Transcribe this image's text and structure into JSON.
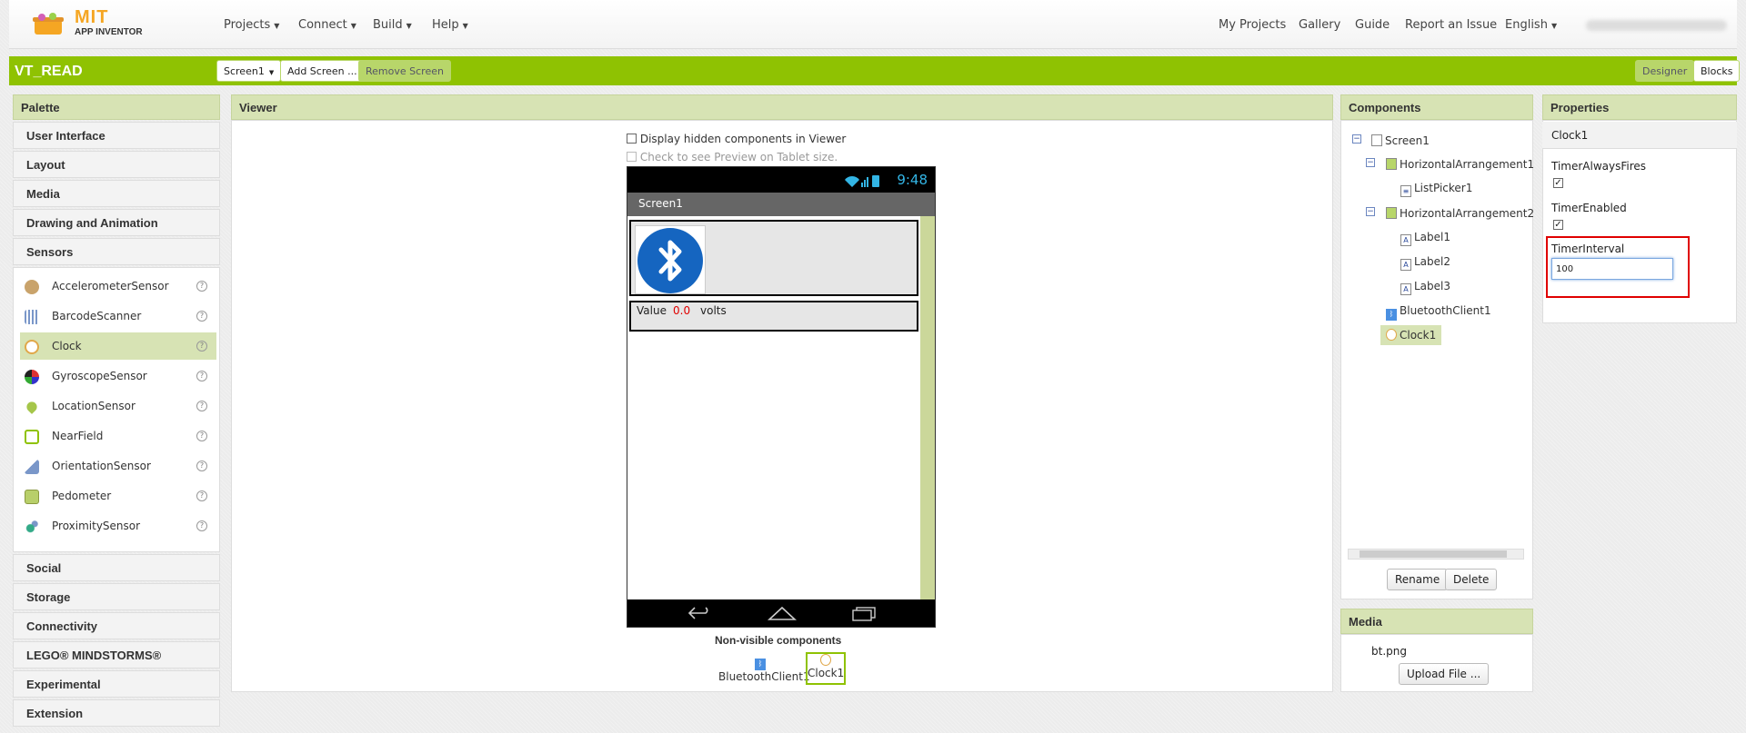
{
  "app": {
    "logo_title": "MIT",
    "logo_subtitle": "APP INVENTOR"
  },
  "topnav": {
    "menus": [
      {
        "label": "Projects"
      },
      {
        "label": "Connect"
      },
      {
        "label": "Build"
      },
      {
        "label": "Help"
      }
    ],
    "right_links": [
      {
        "label": "My Projects"
      },
      {
        "label": "Gallery"
      },
      {
        "label": "Guide"
      },
      {
        "label": "Report an Issue"
      },
      {
        "label": "English"
      }
    ]
  },
  "project": {
    "title": "VT_READ",
    "screen_select": "Screen1",
    "add_screen": "Add Screen ...",
    "remove_screen": "Remove Screen",
    "designer": "Designer",
    "blocks": "Blocks"
  },
  "palette": {
    "header": "Palette",
    "categories_top": [
      "User Interface",
      "Layout",
      "Media",
      "Drawing and Animation",
      "Sensors"
    ],
    "sensors": [
      "AccelerometerSensor",
      "BarcodeScanner",
      "Clock",
      "GyroscopeSensor",
      "LocationSensor",
      "NearField",
      "OrientationSensor",
      "Pedometer",
      "ProximitySensor"
    ],
    "selected_sensor": "Clock",
    "categories_bottom": [
      "Social",
      "Storage",
      "Connectivity",
      "LEGO® MINDSTORMS®",
      "Experimental",
      "Extension"
    ]
  },
  "viewer": {
    "header": "Viewer",
    "display_hidden": "Display hidden components in Viewer",
    "tablet_preview": "Check to see Preview on Tablet size.",
    "time": "9:48",
    "screen_title": "Screen1",
    "value_label": "Value",
    "value": "0.0",
    "unit": "volts",
    "nonvisible_title": "Non-visible components",
    "nonvisible": [
      "BluetoothClient1",
      "Clock1"
    ]
  },
  "components": {
    "header": "Components",
    "tree": [
      {
        "label": "Screen1",
        "level": 0,
        "toggle": "−"
      },
      {
        "label": "HorizontalArrangement1",
        "level": 1,
        "toggle": "−"
      },
      {
        "label": "ListPicker1",
        "level": 2,
        "toggle": ""
      },
      {
        "label": "HorizontalArrangement2",
        "level": 1,
        "toggle": "−"
      },
      {
        "label": "Label1",
        "level": 2,
        "toggle": ""
      },
      {
        "label": "Label2",
        "level": 2,
        "toggle": ""
      },
      {
        "label": "Label3",
        "level": 2,
        "toggle": ""
      },
      {
        "label": "BluetoothClient1",
        "level": 1,
        "toggle": ""
      },
      {
        "label": "Clock1",
        "level": 1,
        "toggle": ""
      }
    ],
    "selected": "Clock1",
    "rename": "Rename",
    "delete": "Delete"
  },
  "media": {
    "header": "Media",
    "file": "bt.png",
    "upload": "Upload File ..."
  },
  "properties": {
    "header": "Properties",
    "component": "Clock1",
    "timer_always_fires_label": "TimerAlwaysFires",
    "timer_always_fires": true,
    "timer_enabled_label": "TimerEnabled",
    "timer_enabled": true,
    "timer_interval_label": "TimerInterval",
    "timer_interval": "100"
  },
  "colors": {
    "accent": "#8fc202",
    "panel_header": "#d7e3b4",
    "highlight": "#e00000",
    "value": "#e00000"
  }
}
